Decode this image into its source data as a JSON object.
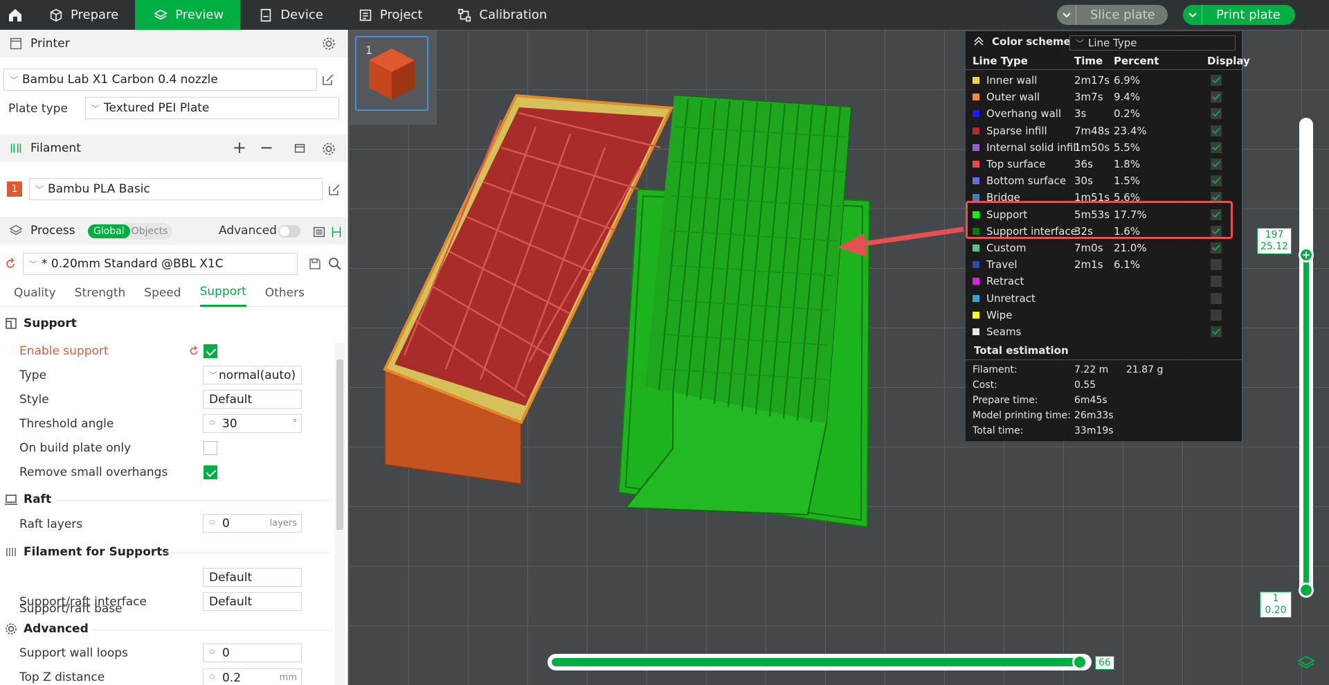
{
  "topbar": {
    "tabs": [
      {
        "label": "Prepare",
        "icon": "cube-icon"
      },
      {
        "label": "Preview",
        "icon": "layers-icon",
        "active": true
      },
      {
        "label": "Device",
        "icon": "device-icon"
      },
      {
        "label": "Project",
        "icon": "project-icon"
      },
      {
        "label": "Calibration",
        "icon": "calibration-icon"
      }
    ],
    "slice_label": "Slice plate",
    "print_label": "Print plate"
  },
  "printer": {
    "title": "Printer",
    "model": "Bambu Lab X1 Carbon 0.4 nozzle",
    "plate_type_label": "Plate type",
    "plate_type": "Textured PEI Plate"
  },
  "filament": {
    "title": "Filament",
    "slot": "1",
    "name": "Bambu PLA Basic",
    "color": "#e05a2b"
  },
  "process": {
    "title": "Process",
    "toggle_global": "Global",
    "toggle_objects": "Objects",
    "advanced_label": "Advanced",
    "preset": "* 0.20mm Standard @BBL X1C",
    "tabs": [
      "Quality",
      "Strength",
      "Speed",
      "Support",
      "Others"
    ],
    "active_tab": "Support"
  },
  "support": {
    "group_title": "Support",
    "enable_label": "Enable support",
    "type_label": "Type",
    "type_value": "normal(auto)",
    "style_label": "Style",
    "style_value": "Default",
    "threshold_label": "Threshold angle",
    "threshold_value": "30",
    "threshold_unit": "°",
    "build_plate_label": "On build plate only",
    "remove_small_label": "Remove small overhangs"
  },
  "raft": {
    "group_title": "Raft",
    "layers_label": "Raft layers",
    "layers_value": "0",
    "layers_unit": "layers"
  },
  "filament_supports": {
    "group_title": "Filament for Supports",
    "base_label": "Support/raft base",
    "base_value": "Default",
    "interface_label": "Support/raft interface",
    "interface_value": "Default"
  },
  "advanced": {
    "group_title": "Advanced",
    "wall_loops_label": "Support wall loops",
    "wall_loops_value": "0",
    "top_z_label": "Top Z distance",
    "top_z_value": "0.2",
    "top_z_unit": "mm"
  },
  "legend": {
    "title": "Color scheme",
    "scheme": "Line Type",
    "col_type": "Line Type",
    "col_time": "Time",
    "col_percent": "Percent",
    "col_display": "Display",
    "rows": [
      {
        "name": "Inner wall",
        "time": "2m17s",
        "percent": "6.9%",
        "color": "#f2d335",
        "display": true
      },
      {
        "name": "Outer wall",
        "time": "3m7s",
        "percent": "9.4%",
        "color": "#f08a3a",
        "display": true
      },
      {
        "name": "Overhang wall",
        "time": "3s",
        "percent": "0.2%",
        "color": "#1a1aff",
        "display": true
      },
      {
        "name": "Sparse infill",
        "time": "7m48s",
        "percent": "23.4%",
        "color": "#b02e2e",
        "display": true
      },
      {
        "name": "Internal solid infill",
        "time": "1m50s",
        "percent": "5.5%",
        "color": "#9b5ccc",
        "display": true
      },
      {
        "name": "Top surface",
        "time": "36s",
        "percent": "1.8%",
        "color": "#e84a4a",
        "display": true
      },
      {
        "name": "Bottom surface",
        "time": "30s",
        "percent": "1.5%",
        "color": "#6a6ad8",
        "display": true
      },
      {
        "name": "Bridge",
        "time": "1m51s",
        "percent": "5.6%",
        "color": "#4a7ab8",
        "display": true
      },
      {
        "name": "Support",
        "time": "5m53s",
        "percent": "17.7%",
        "color": "#00ff00",
        "display": true
      },
      {
        "name": "Support interface",
        "time": "32s",
        "percent": "1.6%",
        "color": "#0a7a0a",
        "display": true
      },
      {
        "name": "Custom",
        "time": "7m0s",
        "percent": "21.0%",
        "color": "#4ec79a",
        "display": true
      },
      {
        "name": "Travel",
        "time": "2m1s",
        "percent": "6.1%",
        "color": "#2a4aa8",
        "display": false
      },
      {
        "name": "Retract",
        "time": "",
        "percent": "",
        "color": "#e020e0",
        "display": false
      },
      {
        "name": "Unretract",
        "time": "",
        "percent": "",
        "color": "#3aa0d0",
        "display": false
      },
      {
        "name": "Wipe",
        "time": "",
        "percent": "",
        "color": "#ffff00",
        "display": false
      },
      {
        "name": "Seams",
        "time": "",
        "percent": "",
        "color": "#e8e8e8",
        "display": true
      }
    ],
    "total_title": "Total estimation",
    "filament_label": "Filament:",
    "filament_length": "7.22 m",
    "filament_weight": "21.87 g",
    "cost_label": "Cost:",
    "cost_value": "0.55",
    "prepare_label": "Prepare time:",
    "prepare_value": "6m45s",
    "model_label": "Model printing time:",
    "model_value": "26m33s",
    "total_label": "Total time:",
    "total_value": "33m19s"
  },
  "preview": {
    "plate_number": "1",
    "layer_top": "197",
    "height_top": "25.12",
    "layer_bottom": "1",
    "height_bottom": "0.20",
    "move_value": "66"
  }
}
